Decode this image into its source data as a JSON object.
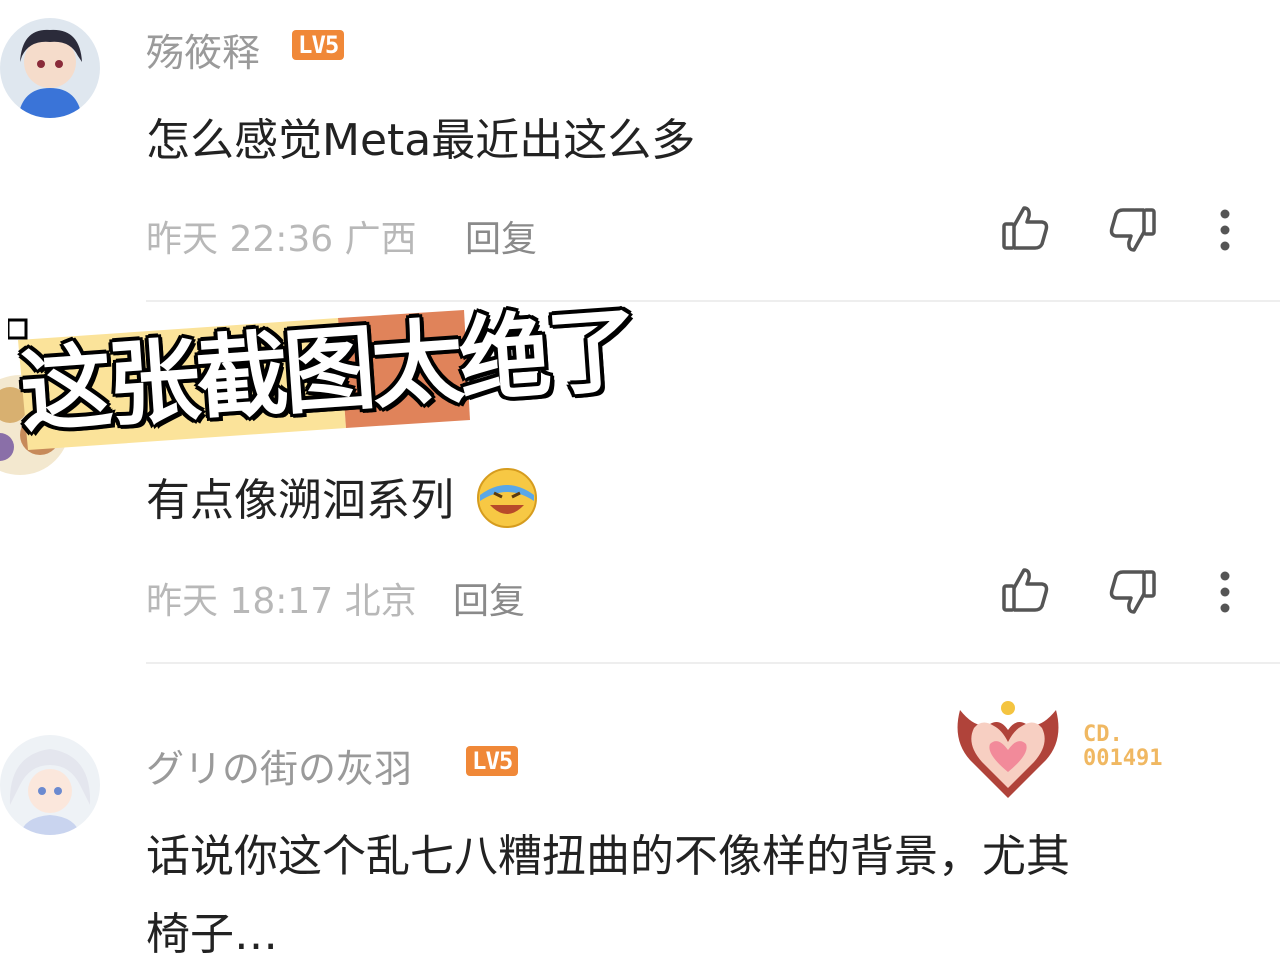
{
  "comments": [
    {
      "username": "殇筱释",
      "level": "LV5",
      "content": "怎么感觉Meta最近出这么多",
      "time": "昨天 22:36",
      "location": "广西",
      "reply_label": "回复"
    },
    {
      "username": "",
      "level": "",
      "content": "有点像溯洄系列",
      "emoji": "laughing-tears-emoji",
      "time": "昨天 18:17",
      "location": "北京",
      "reply_label": "回复"
    },
    {
      "username": "グリの街の灰羽",
      "level": "LV5",
      "content_line1": "话说你这个乱七八糟扭曲的不像样的背景，尤其",
      "content_line2": "椅子…",
      "badge_line1": "CD.",
      "badge_line2": "001491"
    }
  ],
  "overlay": {
    "text": "这张截图太绝了"
  },
  "colors": {
    "level_badge": "#f08838",
    "overlay_yellow": "#fbe39a",
    "overlay_orange": "#e0835a"
  },
  "icons": [
    "thumbs-up-icon",
    "thumbs-down-icon",
    "more-icon"
  ]
}
